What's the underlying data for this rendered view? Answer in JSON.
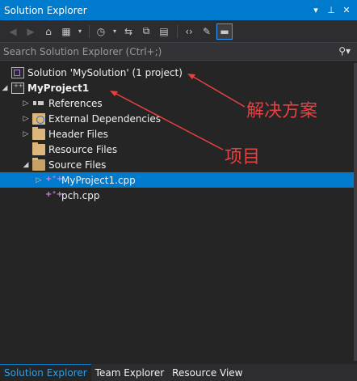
{
  "window": {
    "title": "Solution Explorer",
    "buttons": [
      "▾",
      "⊥",
      "✕"
    ]
  },
  "toolbar": {
    "icons": [
      "back-icon",
      "forward-icon",
      "home-icon",
      "switch-views-icon",
      "dropdown-icon",
      "pending-changes-icon",
      "sync-icon",
      "collapse-all-icon",
      "show-all-files-icon",
      "view-code-icon",
      "properties-icon",
      "preview-icon"
    ]
  },
  "search": {
    "placeholder": "Search Solution Explorer (Ctrl+;)"
  },
  "tree": {
    "solution": "Solution 'MySolution' (1 project)",
    "project": "MyProject1",
    "items": [
      {
        "label": "References"
      },
      {
        "label": "External Dependencies"
      },
      {
        "label": "Header Files"
      },
      {
        "label": "Resource Files"
      },
      {
        "label": "Source Files"
      },
      {
        "label": "MyProject1.cpp"
      },
      {
        "label": "pch.cpp"
      }
    ]
  },
  "annotations": {
    "solution_label": "解决方案",
    "project_label": "项目",
    "color": "#e84040"
  },
  "tabs": [
    {
      "label": "Solution Explorer"
    },
    {
      "label": "Team Explorer"
    },
    {
      "label": "Resource View"
    }
  ],
  "colors": {
    "accent": "#007acc",
    "background": "#252526"
  }
}
